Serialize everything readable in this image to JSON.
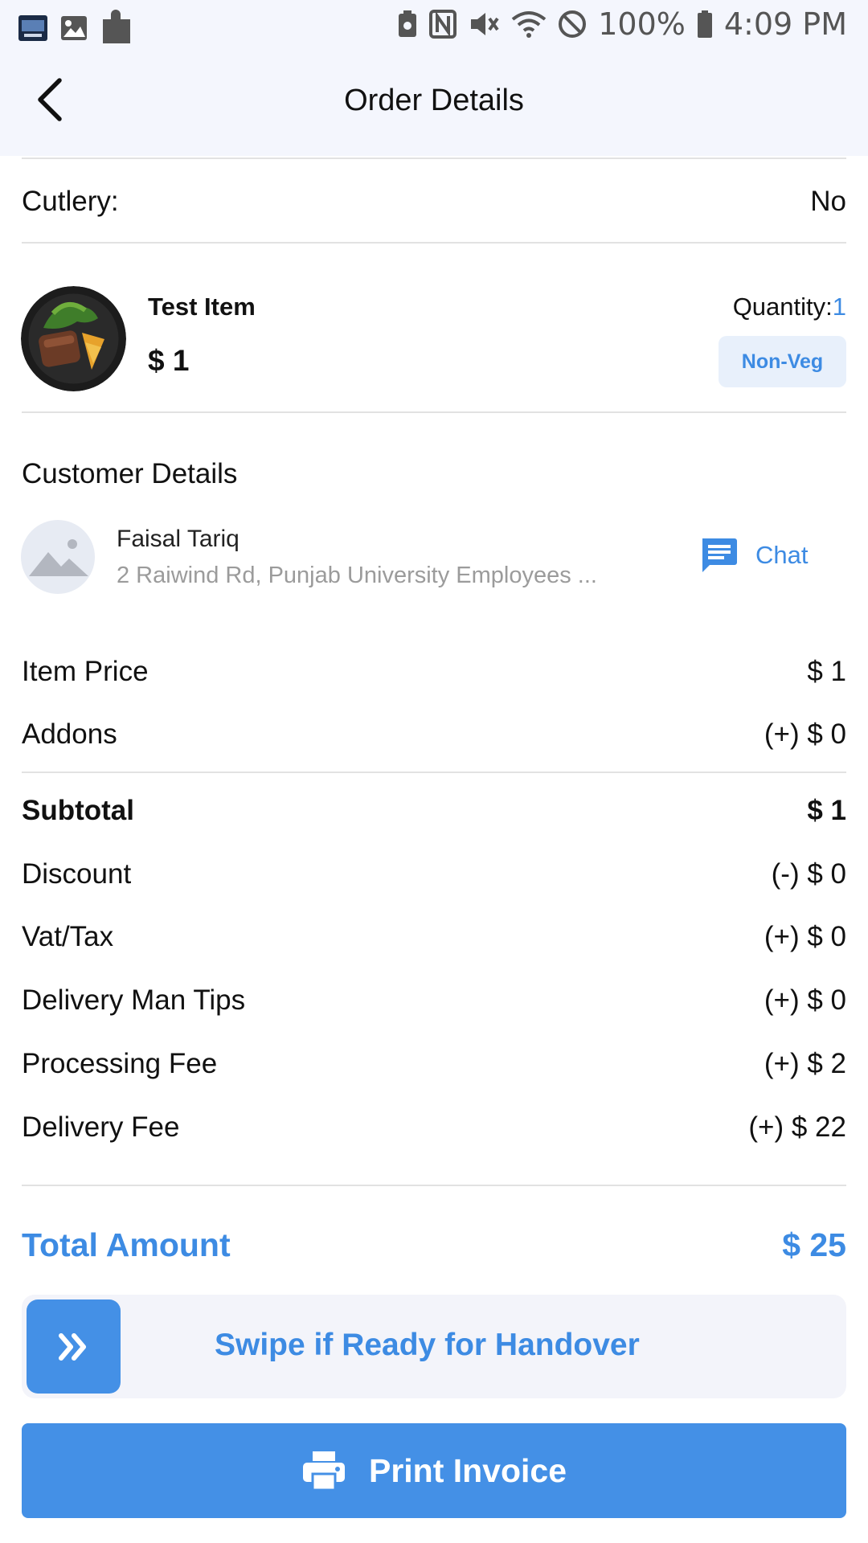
{
  "status_bar": {
    "battery": "100%",
    "time": "4:09 PM",
    "icons": [
      "app-thumbnail-icon",
      "gallery-icon",
      "puzzle-icon",
      "recycle-icon",
      "nfc-icon",
      "vibrate-mute-icon",
      "wifi-icon",
      "do-not-disturb-icon",
      "battery-icon"
    ]
  },
  "header": {
    "title": "Order Details",
    "back_icon": "back-arrow-icon"
  },
  "cutlery": {
    "label": "Cutlery:",
    "value": "No"
  },
  "item": {
    "name": "Test Item",
    "price": "$ 1",
    "quantity_label": "Quantity:",
    "quantity_value": "1",
    "tag": "Non-Veg"
  },
  "customer": {
    "section_title": "Customer Details",
    "name": "Faisal Tariq",
    "address": "2 Raiwind Rd, Punjab University Employees ...",
    "chat_label": "Chat"
  },
  "summary": {
    "item_price": {
      "label": "Item Price",
      "value": "$ 1"
    },
    "addons": {
      "label": "Addons",
      "value": "(+) $ 0"
    },
    "subtotal": {
      "label": "Subtotal",
      "value": "$ 1"
    },
    "discount": {
      "label": "Discount",
      "value": "(-) $ 0"
    },
    "vat": {
      "label": "Vat/Tax",
      "value": "(+) $ 0"
    },
    "tips": {
      "label": "Delivery Man Tips",
      "value": "(+) $ 0"
    },
    "processing": {
      "label": "Processing Fee",
      "value": "(+) $ 2"
    },
    "delivery": {
      "label": "Delivery Fee",
      "value": "(+) $ 22"
    },
    "total": {
      "label": "Total Amount",
      "value": "$ 25"
    }
  },
  "actions": {
    "swipe_label": "Swipe if Ready for Handover",
    "print_label": "Print Invoice"
  },
  "colors": {
    "accent": "#4490e6",
    "accent_text": "#3d8be3",
    "header_bg": "#f4f6fd"
  }
}
